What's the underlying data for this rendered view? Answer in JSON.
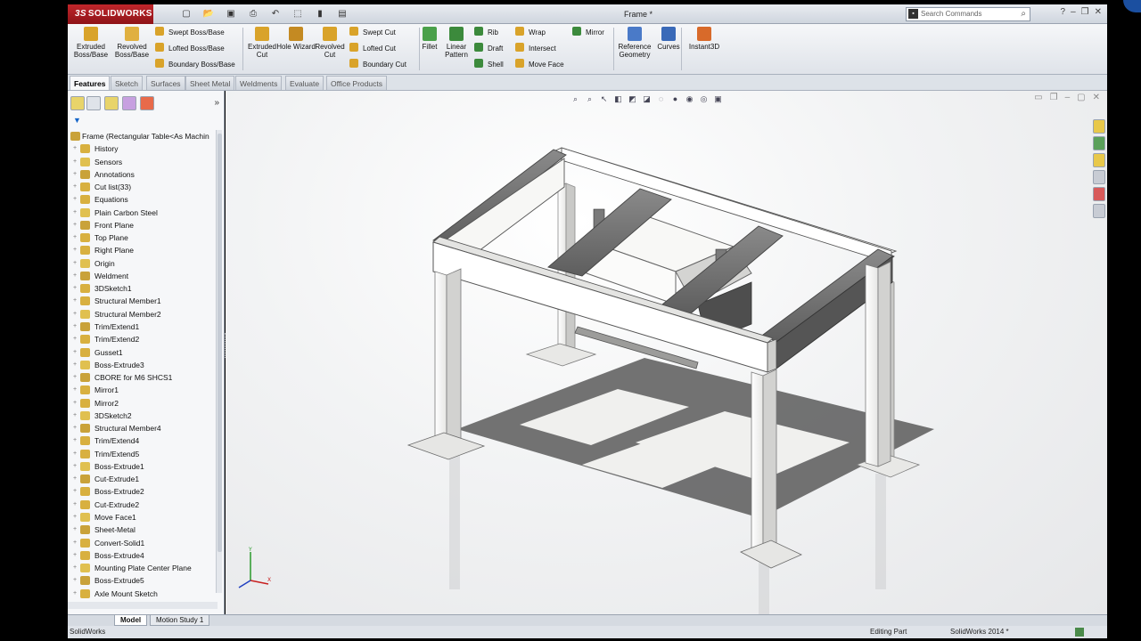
{
  "titlebar": {
    "logo_ds": "3S",
    "logo_text": "SOLIDWORKS",
    "document_title": "Frame *",
    "search_placeholder": "Search Commands",
    "icons": [
      "new-icon",
      "open-icon",
      "save-icon",
      "print-icon",
      "undo-icon",
      "select-icon",
      "rebuild-icon",
      "options-icon"
    ]
  },
  "ribbon": {
    "extruded_boss": "Extruded Boss/Base",
    "revolved_boss": "Revolved Boss/Base",
    "swept_boss": "Swept Boss/Base",
    "lofted_boss": "Lofted Boss/Base",
    "boundary_boss": "Boundary Boss/Base",
    "extruded_cut": "Extruded Cut",
    "hole_wizard": "Hole Wizard",
    "revolved_cut": "Revolved Cut",
    "swept_cut": "Swept Cut",
    "lofted_cut": "Lofted Cut",
    "boundary_cut": "Boundary Cut",
    "fillet": "Fillet",
    "linear_pattern": "Linear Pattern",
    "rib": "Rib",
    "draft": "Draft",
    "shell": "Shell",
    "wrap": "Wrap",
    "intersect": "Intersect",
    "move_face": "Move Face",
    "mirror": "Mirror",
    "reference_geometry": "Reference Geometry",
    "curves": "Curves",
    "instant3d": "Instant3D"
  },
  "command_tabs": [
    "Features",
    "Sketch",
    "Surfaces",
    "Sheet Metal",
    "Weldments",
    "Evaluate",
    "Office Products"
  ],
  "tree": {
    "root": "Frame  (Rectangular Table<As Machin",
    "items": [
      "History",
      "Sensors",
      "Annotations",
      "Cut list(33)",
      "Equations",
      "Plain Carbon Steel",
      "Front Plane",
      "Top Plane",
      "Right Plane",
      "Origin",
      "Weldment",
      "3DSketch1",
      "Structural Member1",
      "Structural Member2",
      "Trim/Extend1",
      "Trim/Extend2",
      "Gusset1",
      "Boss-Extrude3",
      "CBORE for M6 SHCS1",
      "Mirror1",
      "Mirror2",
      "3DSketch2",
      "Structural Member4",
      "Trim/Extend4",
      "Trim/Extend5",
      "Boss-Extrude1",
      "Cut-Extrude1",
      "Boss-Extrude2",
      "Cut-Extrude2",
      "Move Face1",
      "Sheet-Metal",
      "Convert-Solid1",
      "Boss-Extrude4",
      "Mounting Plate Center Plane",
      "Boss-Extrude5",
      "Axle Mount Sketch"
    ]
  },
  "bottom_tabs": [
    "Model",
    "Motion Study 1"
  ],
  "status": {
    "app": "SolidWorks",
    "mode": "Editing Part",
    "version": "SolidWorks 2014 *"
  },
  "colors": {
    "frame_light": "#f4f4f2",
    "frame_dark": "#6e6e6e",
    "logo_red": "#b01e24",
    "accent_blue": "#1b4fa0"
  }
}
